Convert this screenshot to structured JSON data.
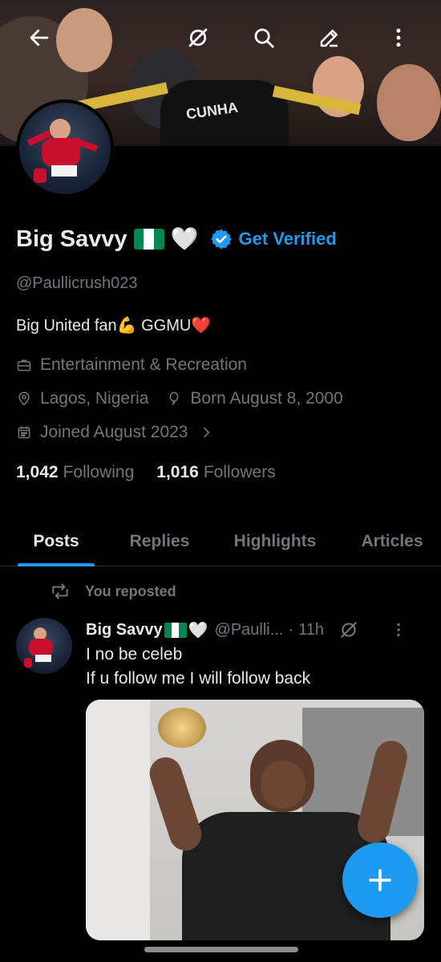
{
  "profile": {
    "name": "Big Savvy",
    "name_emoji_heart": "🤍",
    "get_verified": "Get Verified",
    "handle": "@Paullicrush023",
    "bio_text": "Big United fan",
    "bio_emoji_muscle": "💪",
    "bio_tag": "GGMU",
    "bio_emoji_heart": "❤️",
    "category": "Entertainment & Recreation",
    "location": "Lagos, Nigeria",
    "birthday": "Born August 8, 2000",
    "joined": "Joined August 2023",
    "following_count": "1,042",
    "following_label": "Following",
    "followers_count": "1,016",
    "followers_label": "Followers"
  },
  "banner": {
    "jersey_text": "CUNHA"
  },
  "tabs": [
    {
      "label": "Posts",
      "active": true
    },
    {
      "label": "Replies",
      "active": false
    },
    {
      "label": "Highlights",
      "active": false
    },
    {
      "label": "Articles",
      "active": false
    }
  ],
  "post": {
    "repost_label": "You reposted",
    "author_name": "Big Savvy",
    "author_heart": "🤍",
    "author_handle": "@Paulli...",
    "separator": "·",
    "time": "11h",
    "line1": "I no be celeb",
    "line2": "If u follow me I will follow back"
  },
  "icons": {
    "back": "arrow-left-icon",
    "grok": "grok-icon",
    "search": "search-icon",
    "edit": "pencil-icon",
    "more": "more-vertical-icon",
    "category": "briefcase-icon",
    "location": "location-pin-icon",
    "birthday": "balloon-icon",
    "joined": "calendar-icon",
    "verified": "verified-badge-icon",
    "repost": "repost-icon",
    "compose": "plus-icon"
  },
  "colors": {
    "accent": "#1d9bf0",
    "background": "#000000",
    "text_primary": "#e7e9ea",
    "text_secondary": "#71767b",
    "flag_green": "#008751",
    "flag_white": "#ffffff"
  }
}
